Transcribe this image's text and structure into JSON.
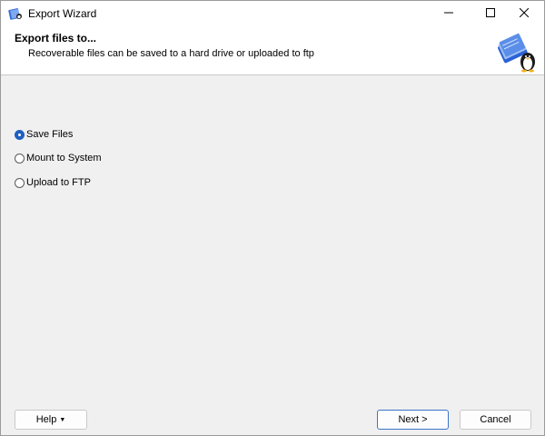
{
  "window": {
    "title": "Export Wizard",
    "app_icon": "export-wizard-icon",
    "controls": {
      "minimize": "minimize-icon",
      "maximize": "maximize-icon",
      "close": "close-icon"
    }
  },
  "header": {
    "title": "Export files to...",
    "subtitle": "Recoverable files can be saved to a hard drive or uploaded to ftp",
    "art": "book-with-penguin-icon"
  },
  "options": [
    {
      "label": "Save Files",
      "selected": true
    },
    {
      "label": "Mount to System",
      "selected": false
    },
    {
      "label": "Upload to FTP",
      "selected": false
    }
  ],
  "buttons": {
    "help": "Help",
    "next": "Next >",
    "cancel": "Cancel"
  },
  "colors": {
    "accent": "#1f5fbf",
    "window_bg": "#f0f0f0",
    "header_bg": "#ffffff"
  }
}
